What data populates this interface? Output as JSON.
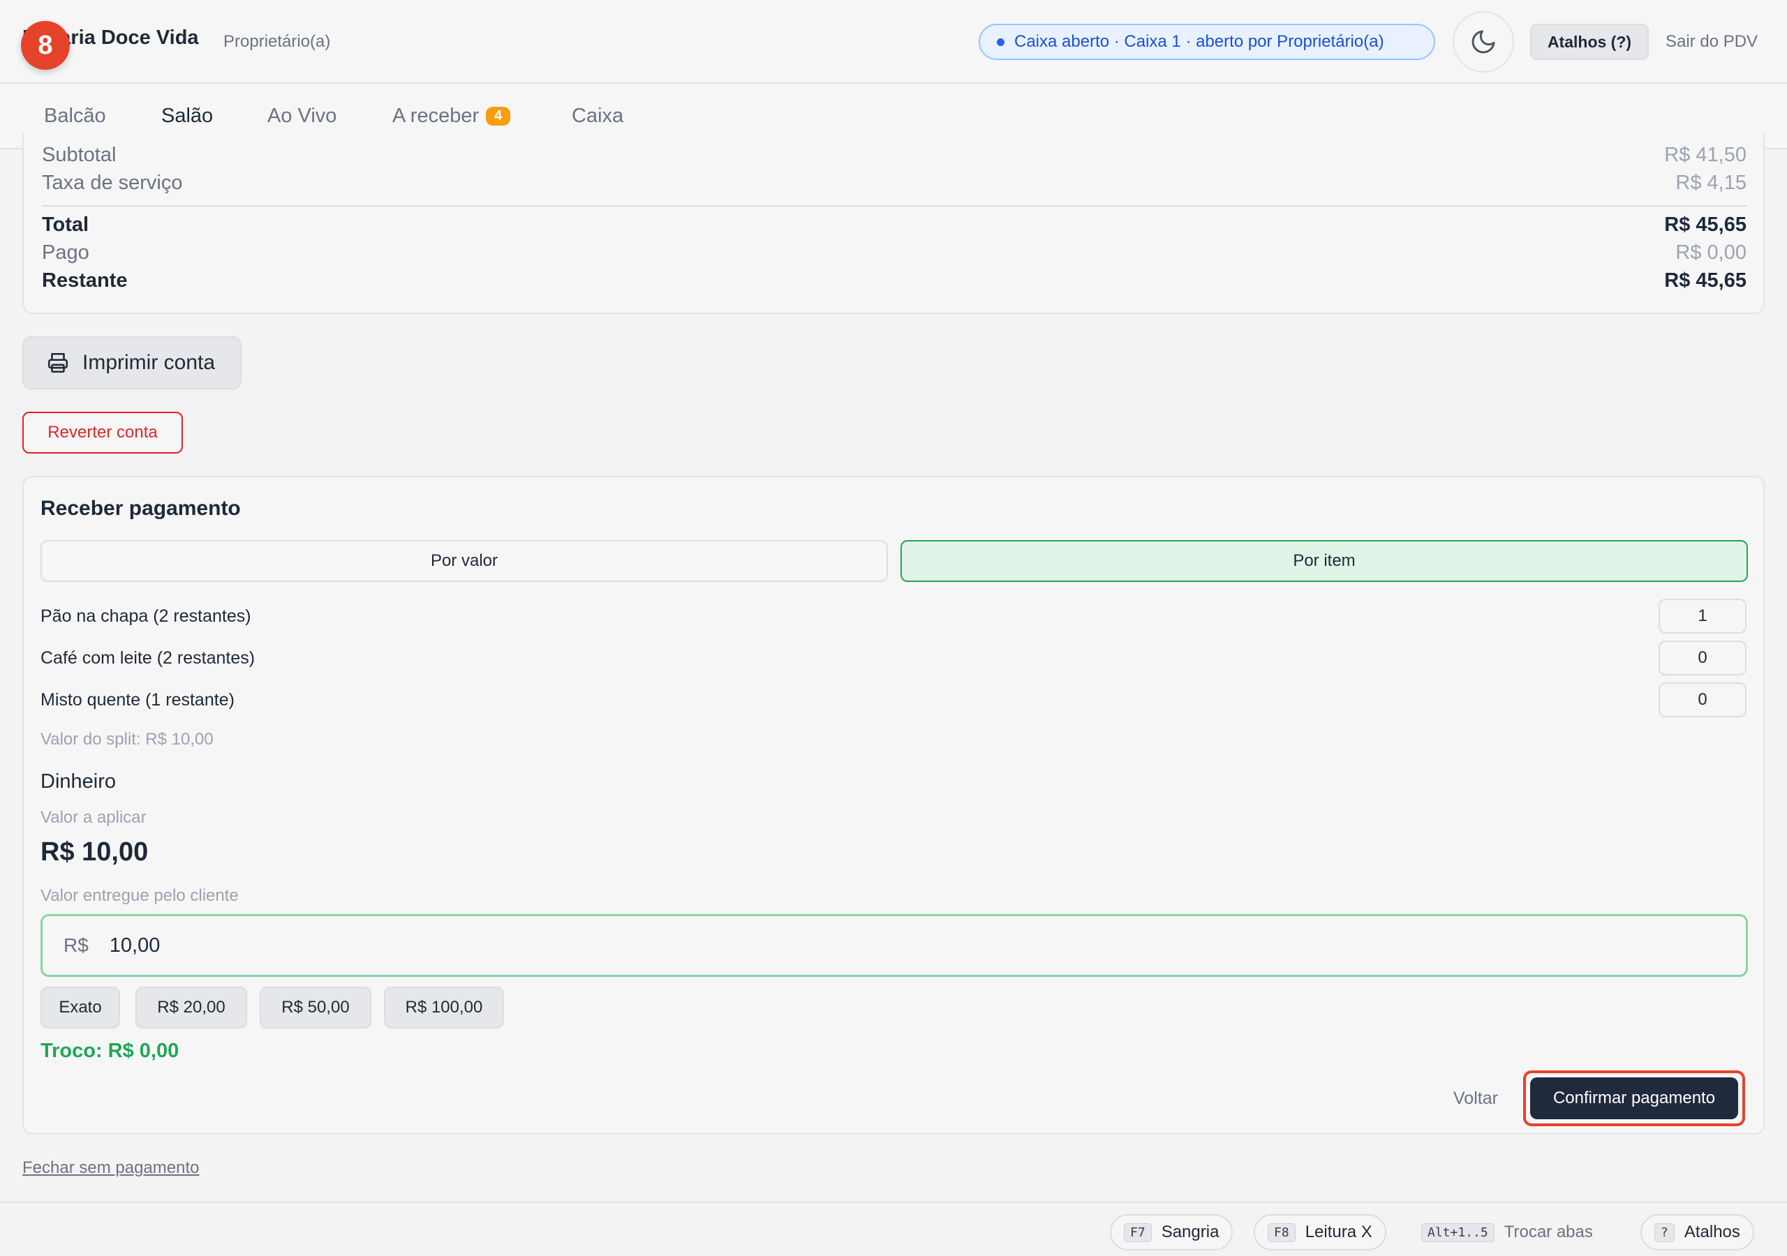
{
  "header": {
    "step_number": "8",
    "brand": "Padaria Doce Vida",
    "role": "Proprietário(a)",
    "cash_status": "Caixa aberto · Caixa 1 · aberto por Proprietário(a)",
    "shortcuts_label": "Atalhos (?)",
    "exit_label": "Sair do PDV"
  },
  "tabs": [
    {
      "label": "Balcão",
      "active": false
    },
    {
      "label": "Salão",
      "active": true
    },
    {
      "label": "Ao Vivo",
      "active": false
    },
    {
      "label": "A receber",
      "active": false,
      "count": "4"
    },
    {
      "label": "Caixa",
      "active": false
    }
  ],
  "totals": {
    "subtotal_label": "Subtotal",
    "subtotal_value": "R$ 41,50",
    "service_label": "Taxa de serviço",
    "service_value": "R$ 4,15",
    "total_label": "Total",
    "total_value": "R$ 45,65",
    "paid_label": "Pago",
    "paid_value": "R$ 0,00",
    "remaining_label": "Restante",
    "remaining_value": "R$ 45,65"
  },
  "actions": {
    "print_label": "Imprimir conta",
    "revert_label": "Reverter conta"
  },
  "payment": {
    "title": "Receber pagamento",
    "mode_by_value": "Por valor",
    "mode_by_item": "Por item",
    "selected_mode": "Por item",
    "items": [
      {
        "label": "Pão na chapa (2 restantes)",
        "qty": "1"
      },
      {
        "label": "Café com leite (2 restantes)",
        "qty": "0"
      },
      {
        "label": "Misto quente (1 restante)",
        "qty": "0"
      }
    ],
    "split_note": "Valor do split: R$ 10,00",
    "method": "Dinheiro",
    "apply_label": "Valor a aplicar",
    "apply_value": "R$ 10,00",
    "given_label": "Valor entregue pelo cliente",
    "currency": "R$",
    "given_value": "10,00",
    "quick_amounts": [
      "Exato",
      "R$ 20,00",
      "R$ 50,00",
      "R$ 100,00"
    ],
    "change": "Troco: R$ 0,00",
    "back_label": "Voltar",
    "confirm_label": "Confirmar pagamento"
  },
  "close_without_payment": "Fechar sem pagamento",
  "footer": [
    {
      "key": "F7",
      "label": "Sangria"
    },
    {
      "key": "F8",
      "label": "Leitura X"
    },
    {
      "key": "Alt+1..5",
      "label": "Trocar abas"
    },
    {
      "key": "?",
      "label": "Atalhos"
    }
  ],
  "colors": {
    "accent_green": "#22a559",
    "danger_red": "#dc2626",
    "highlight_ring": "#e5432a",
    "info_blue": "#1d4ed8",
    "badge_orange": "#f59e0b",
    "dark_button": "#1f2a3c"
  },
  "icons": {
    "theme": "moon-icon",
    "print": "printer-icon",
    "status": "status-dot-icon"
  }
}
